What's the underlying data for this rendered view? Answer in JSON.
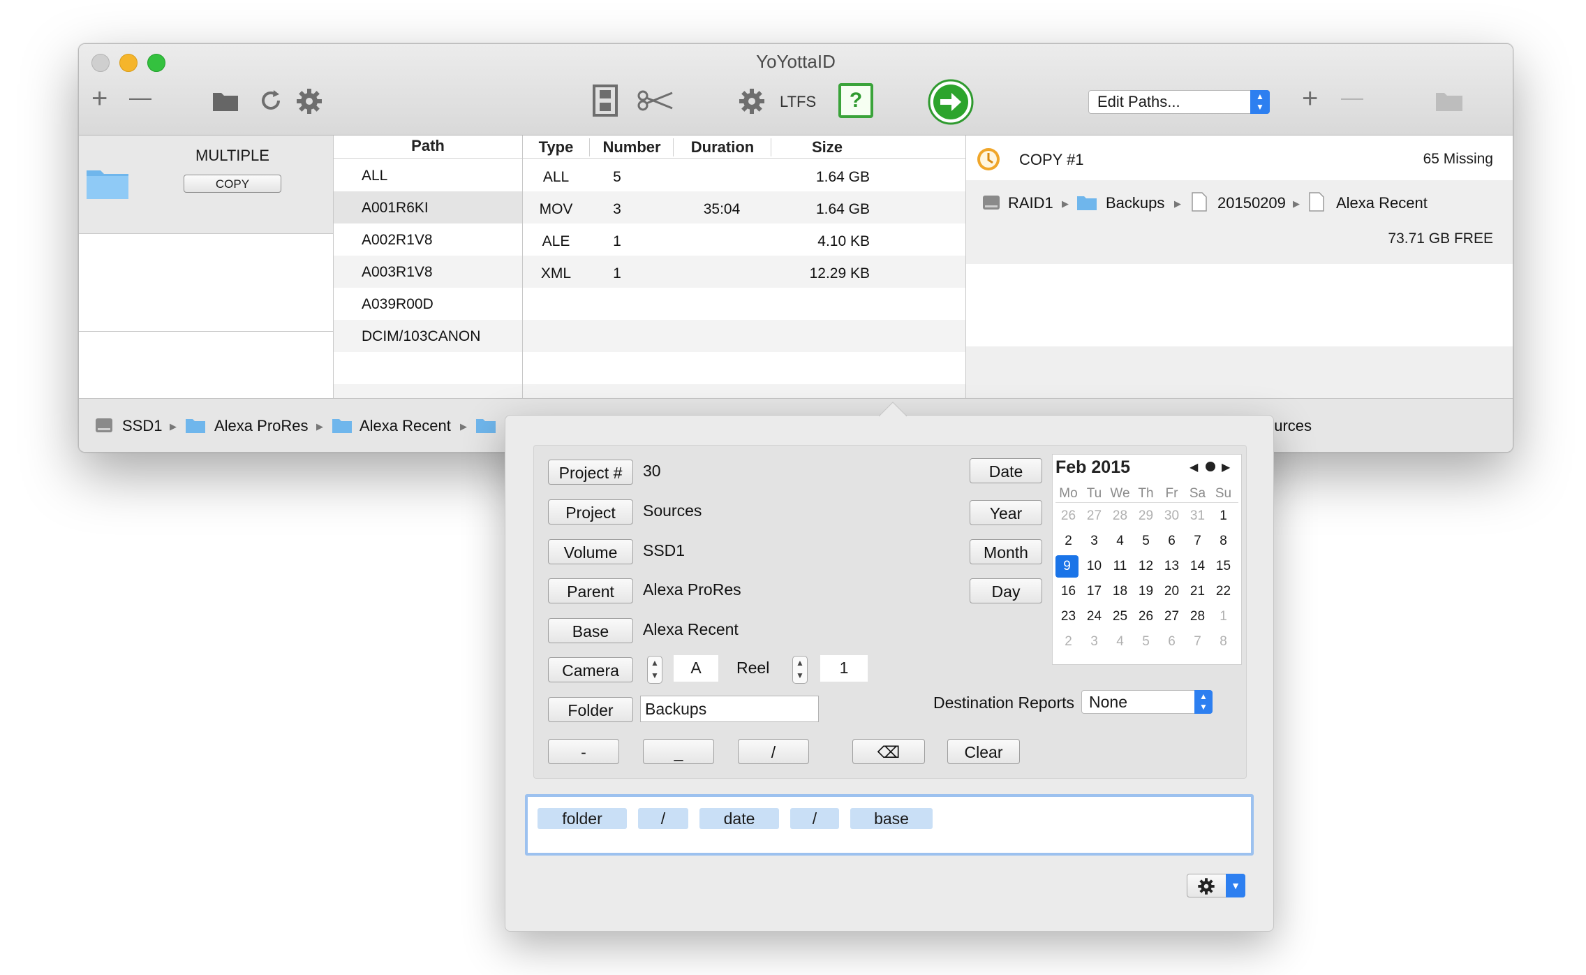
{
  "window": {
    "title": "YoYottaID",
    "toolbar": {
      "add_left": "+",
      "remove_left": "—",
      "ltfs_label": "LTFS",
      "help_label": "?",
      "edit_paths": "Edit Paths...",
      "add_right": "+",
      "remove_right": "—"
    }
  },
  "source": {
    "title": "MULTIPLE",
    "copy_button": "COPY"
  },
  "paths": {
    "header": "Path",
    "rows": [
      "ALL",
      "A001R6KI",
      "A002R1V8",
      "A003R1V8",
      "A039R00D",
      "DCIM/103CANON"
    ]
  },
  "types_table": {
    "headers": [
      "Type",
      "Number",
      "Duration",
      "Size"
    ],
    "rows": [
      [
        "ALL",
        "5",
        "",
        "1.64 GB"
      ],
      [
        "MOV",
        "3",
        "35:04",
        "1.64 GB"
      ],
      [
        "ALE",
        "1",
        "",
        "4.10 KB"
      ],
      [
        "XML",
        "1",
        "",
        "12.29 KB"
      ]
    ]
  },
  "destination": {
    "copy_label": "COPY #1",
    "missing": "65 Missing",
    "breadcrumb": [
      "RAID1",
      "Backups",
      "20150209",
      "Alexa Recent"
    ],
    "free": "73.71 GB FREE"
  },
  "bottom_bar": {
    "breadcrumb": [
      "SSD1",
      "Alexa ProRes",
      "Alexa Recent"
    ],
    "trailing": "ources"
  },
  "popover": {
    "project_num_btn": "Project #",
    "project_num_val": "30",
    "project_btn": "Project",
    "project_val": "Sources",
    "volume_btn": "Volume",
    "volume_val": "SSD1",
    "parent_btn": "Parent",
    "parent_val": "Alexa ProRes",
    "base_btn": "Base",
    "base_val": "Alexa Recent",
    "camera_btn": "Camera",
    "camera_val": "A",
    "reel_label": "Reel",
    "reel_val": "1",
    "folder_btn": "Folder",
    "folder_val": "Backups",
    "date_btn": "Date",
    "year_btn": "Year",
    "month_btn": "Month",
    "day_btn": "Day",
    "dash_btn": "-",
    "underscore_btn": "_",
    "slash_btn": "/",
    "delete_btn": "⌫",
    "clear_btn": "Clear",
    "dest_reports_label": "Destination Reports",
    "dest_reports_value": "None",
    "tokens": [
      "folder",
      "/",
      "date",
      "/",
      "base"
    ]
  },
  "calendar": {
    "month_label": "Feb 2015",
    "weekdays": [
      "Mo",
      "Tu",
      "We",
      "Th",
      "Fr",
      "Sa",
      "Su"
    ],
    "weeks": [
      [
        "26",
        "27",
        "28",
        "29",
        "30",
        "31",
        "1"
      ],
      [
        "2",
        "3",
        "4",
        "5",
        "6",
        "7",
        "8"
      ],
      [
        "9",
        "10",
        "11",
        "12",
        "13",
        "14",
        "15"
      ],
      [
        "16",
        "17",
        "18",
        "19",
        "20",
        "21",
        "22"
      ],
      [
        "23",
        "24",
        "25",
        "26",
        "27",
        "28",
        "1"
      ],
      [
        "2",
        "3",
        "4",
        "5",
        "6",
        "7",
        "8"
      ]
    ],
    "selected": "9",
    "selected_color": "#1a74e8"
  },
  "colors": {
    "close": "#c8c8c8",
    "minimize": "#f5b52b",
    "zoom": "#34c13f",
    "go": "#29a329",
    "help_border": "#3aa33a",
    "folder": "#6fb6ec",
    "token": "#c9dff6"
  }
}
